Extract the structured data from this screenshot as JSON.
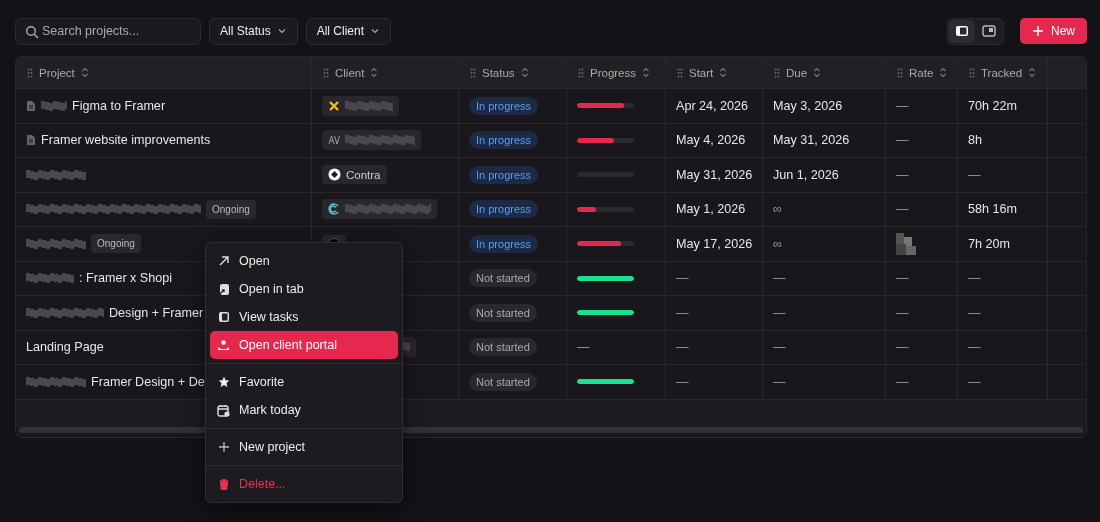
{
  "toolbar": {
    "search": {
      "placeholder": "Search projects..."
    },
    "filters": [
      {
        "label": "All Status"
      },
      {
        "label": "All Client"
      }
    ],
    "views": [
      {
        "kind": "list",
        "selected": true
      },
      {
        "kind": "board",
        "selected": false
      }
    ],
    "new_button": {
      "label": "New"
    }
  },
  "table": {
    "columns": [
      "Project",
      "Client",
      "Status",
      "Progress",
      "Start",
      "Due",
      "Rate",
      "Tracked"
    ],
    "rows": [
      {
        "project": {
          "doc_icon": true,
          "redacted": true,
          "name": "Figma to Framer"
        },
        "client": {
          "redacted": true
        },
        "status": {
          "kind": "in_progress",
          "label": "In progress"
        },
        "progress": {
          "level": 0.82
        },
        "start": "Apr 24, 2026",
        "due": "May 3, 2026",
        "rate": "—",
        "tracked": "70h 22m"
      },
      {
        "project": {
          "doc_icon": true,
          "redacted": false,
          "name": "Framer website improvements"
        },
        "client": {
          "redacted": true
        },
        "status": {
          "kind": "in_progress",
          "label": "In progress"
        },
        "progress": {
          "level": 0.65
        },
        "start": "May 4, 2026",
        "due": "May 31, 2026",
        "rate": "—",
        "tracked": "8h"
      },
      {
        "project": {
          "doc_icon": false,
          "redacted": true
        },
        "client": {
          "redacted": false,
          "name": "Contra"
        },
        "status": {
          "kind": "in_progress",
          "label": "In progress"
        },
        "progress": {
          "level": 0
        },
        "start": "May 31, 2026",
        "due": "Jun 1, 2026",
        "rate": "—",
        "tracked": "—"
      },
      {
        "project": {
          "doc_icon": false,
          "redacted": true,
          "badge": "Ongoing"
        },
        "client": {
          "redacted": true
        },
        "status": {
          "kind": "in_progress",
          "label": "In progress"
        },
        "progress": {
          "level": 0.33
        },
        "start": "May 1, 2026",
        "due": "∞",
        "rate": "—",
        "tracked": "58h 16m"
      },
      {
        "project": {
          "doc_icon": false,
          "redacted": true,
          "badge": "Ongoing"
        },
        "client": {
          "redacted": false
        },
        "status": {
          "kind": "in_progress",
          "label": "In progress"
        },
        "progress": {
          "level": 0.77
        },
        "start": "May 17, 2026",
        "due": "∞",
        "rate_redacted": true,
        "tracked": "7h 20m"
      },
      {
        "project": {
          "doc_icon": false,
          "redacted": true,
          "name": ": Framer x Shopi"
        },
        "status": {
          "kind": "not_started",
          "label": "Not started"
        },
        "progress": {
          "level": 1
        },
        "start": "—",
        "due": "—",
        "rate": "—",
        "tracked": "—"
      },
      {
        "project": {
          "doc_icon": false,
          "redacted": true,
          "name": "Design + Framer"
        },
        "status": {
          "kind": "not_started",
          "label": "Not started"
        },
        "progress": {
          "level": 1
        },
        "start": "—",
        "due": "—",
        "rate": "—",
        "tracked": "—"
      },
      {
        "project": {
          "doc_icon": false,
          "redacted": false,
          "name": "Landing Page"
        },
        "client": {
          "redacted": true
        },
        "status": {
          "kind": "not_started",
          "label": "Not started"
        },
        "progress": {
          "text": "—"
        },
        "start": "—",
        "due": "—",
        "rate": "—",
        "tracked": "—"
      },
      {
        "project": {
          "doc_icon": false,
          "redacted": true,
          "name": "Framer Design + De"
        },
        "status": {
          "kind": "not_started",
          "label": "Not started"
        },
        "progress": {
          "level": 1
        },
        "start": "—",
        "due": "—",
        "rate": "—",
        "tracked": "—"
      }
    ]
  },
  "context_menu": {
    "groups": [
      [
        {
          "label": "Open",
          "selected": false
        },
        {
          "label": "Open in tab",
          "selected": false
        },
        {
          "label": "View tasks",
          "selected": false
        },
        {
          "label": "Open client portal",
          "selected": true
        }
      ],
      [
        {
          "label": "Favorite",
          "selected": false
        },
        {
          "label": "Mark today",
          "selected": false
        }
      ],
      [
        {
          "label": "New project",
          "selected": false
        }
      ],
      [
        {
          "label": "Delete...",
          "selected": false,
          "kind": "danger"
        }
      ]
    ]
  }
}
